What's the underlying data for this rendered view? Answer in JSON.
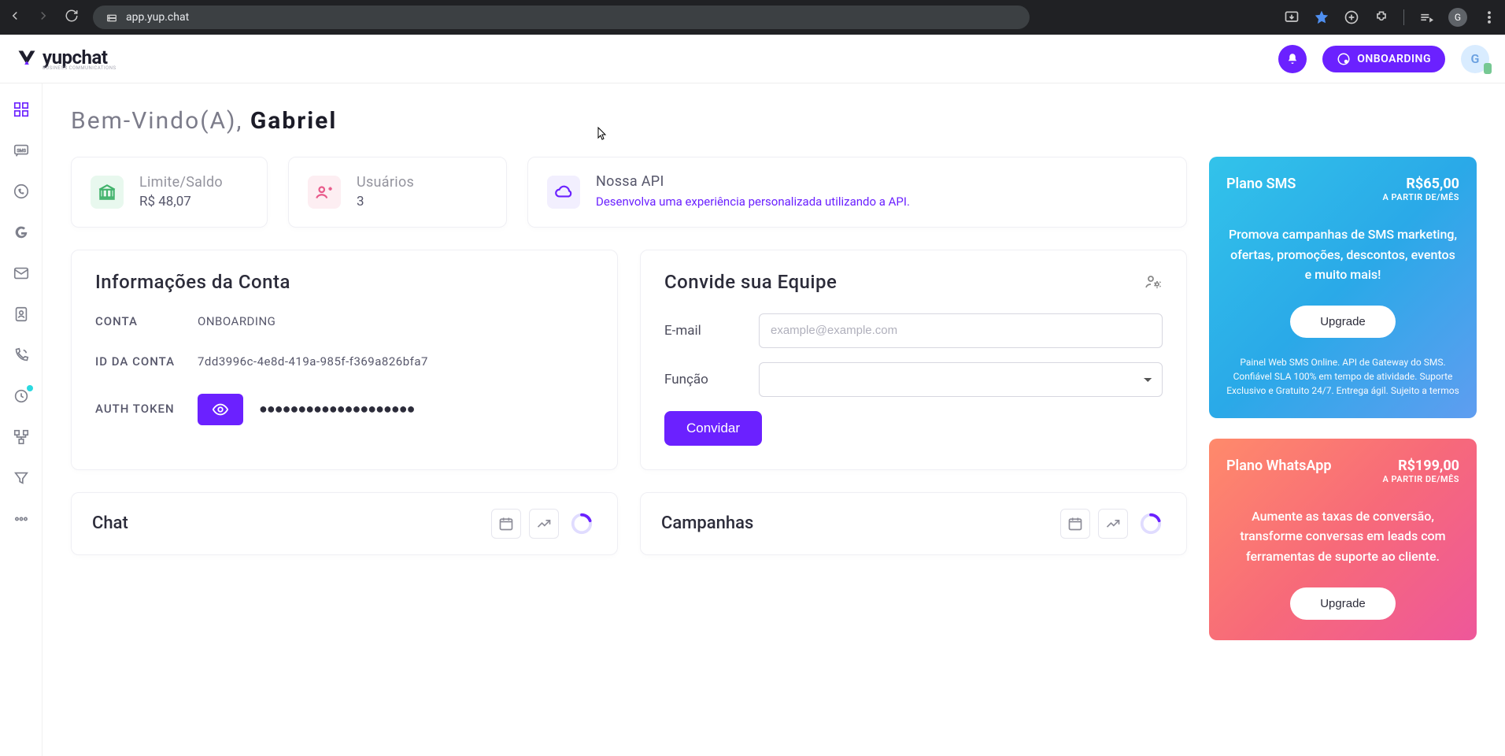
{
  "browser": {
    "url": "app.yup.chat",
    "avatar_letter": "G"
  },
  "header": {
    "logo_text": "yupchat",
    "logo_sub": "BUSINESS COMMUNICATIONS",
    "onboarding_label": "ONBOARDING",
    "avatar_letter": "G"
  },
  "welcome": {
    "prefix": "Bem-Vindo(A), ",
    "name": "Gabriel"
  },
  "stat": {
    "balance": {
      "title": "Limite/Saldo",
      "value": "R$ 48,07"
    },
    "users": {
      "title": "Usuários",
      "value": "3"
    },
    "api": {
      "title": "Nossa API",
      "desc": "Desenvolva uma experiência personalizada utilizando a API."
    }
  },
  "account": {
    "heading": "Informações da Conta",
    "lbl_conta": "CONTA",
    "val_conta": "ONBOARDING",
    "lbl_id": "ID DA CONTA",
    "val_id": "7dd3996c-4e8d-419a-985f-f369a826bfa7",
    "lbl_token": "AUTH TOKEN",
    "masked": "●●●●●●●●●●●●●●●●●●●●"
  },
  "invite": {
    "heading": "Convide sua Equipe",
    "lbl_email": "E-mail",
    "ph_email": "example@example.com",
    "lbl_role": "Função",
    "btn": "Convidar"
  },
  "panels": {
    "chat": "Chat",
    "campaigns": "Campanhas"
  },
  "promo_sms": {
    "name": "Plano SMS",
    "price": "R$65,00",
    "per": "A PARTIR DE/MÊS",
    "desc": "Promova campanhas de SMS marketing, ofertas, promoções, descontos, eventos e muito mais!",
    "btn": "Upgrade",
    "foot": "Painel Web SMS Online. API de Gateway do SMS. Confiável SLA 100% em tempo de atividade. Suporte Exclusivo e Gratuito 24/7. Entrega ágil. Sujeito a termos"
  },
  "promo_wa": {
    "name": "Plano WhatsApp",
    "price": "R$199,00",
    "per": "A PARTIR DE/MÊS",
    "desc": "Aumente as taxas de conversão, transforme conversas em leads com ferramentas de suporte ao cliente.",
    "btn": "Upgrade"
  }
}
